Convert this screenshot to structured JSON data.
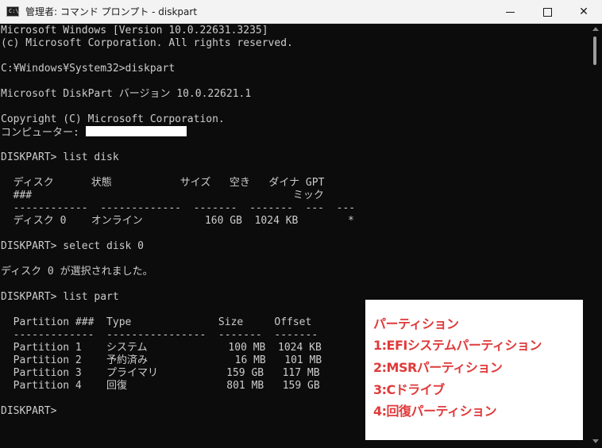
{
  "window": {
    "title": "管理者: コマンド プロンプト - diskpart",
    "icon_label": "C:\\.",
    "minimize": "minimize-icon",
    "maximize": "maximize-icon",
    "close": "✕"
  },
  "console": {
    "lines": [
      "Microsoft Windows [Version 10.0.22631.3235]",
      "(c) Microsoft Corporation. All rights reserved.",
      "",
      "C:¥Windows¥System32>diskpart",
      "",
      "Microsoft DiskPart バージョン 10.0.22621.1",
      "",
      "Copyright (C) Microsoft Corporation.",
      "コンピューター: ",
      "",
      "DISKPART> list disk",
      "",
      "  ディスク      状態           サイズ   空き   ダイナ GPT",
      "  ###                                          ミック",
      "  ------------  -------------  -------  -------  ---  ---",
      "  ディスク 0    オンライン          160 GB  1024 KB        *",
      "",
      "DISKPART> select disk 0",
      "",
      "ディスク 0 が選択されました。",
      "",
      "DISKPART> list part",
      "",
      "  Partition ###  Type              Size     Offset",
      "  -------------  ----------------  -------  -------",
      "  Partition 1    システム             100 MB  1024 KB",
      "  Partition 2    予約済み              16 MB   101 MB",
      "  Partition 3    プライマリ           159 GB   117 MB",
      "  Partition 4    回復                801 MB   159 GB",
      "",
      "DISKPART>"
    ]
  },
  "annotation": {
    "lines": [
      "パーティション",
      "1:EFIシステムパーティション",
      "2:MSRパーティション",
      "3:Cドライブ",
      "4:回復パーティション"
    ],
    "color": "#e03a3a"
  }
}
